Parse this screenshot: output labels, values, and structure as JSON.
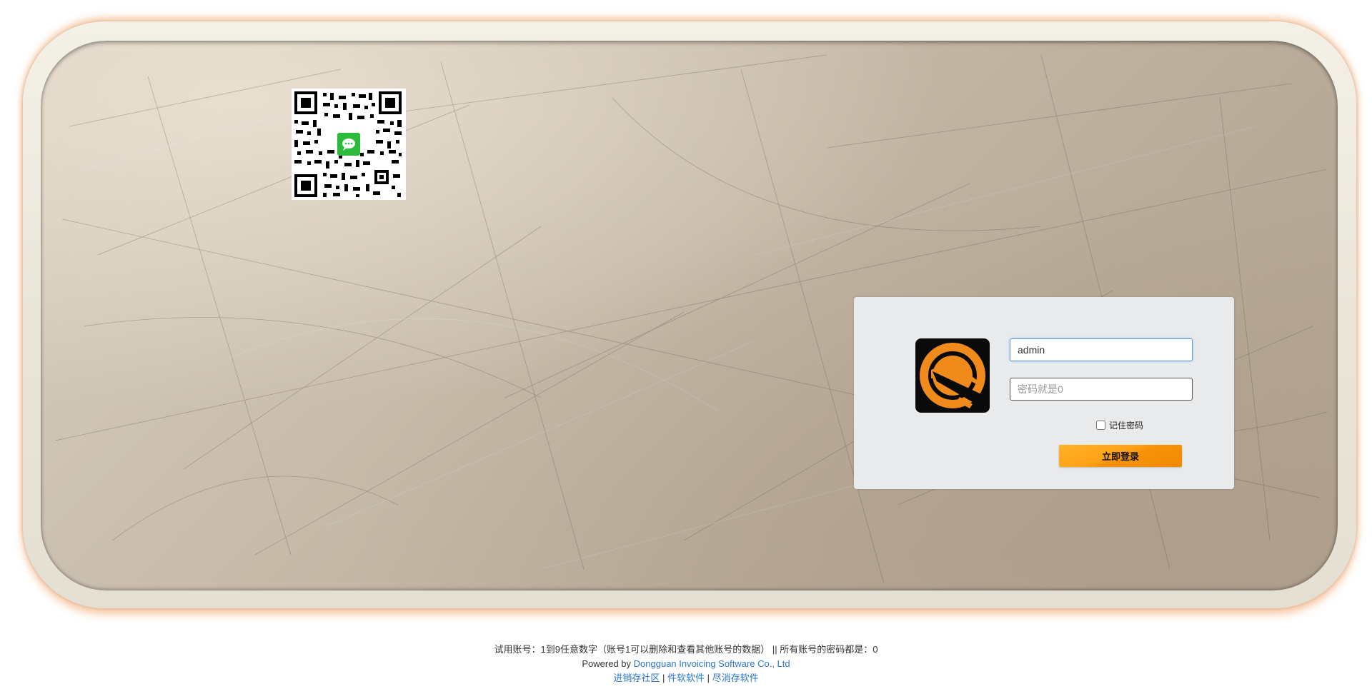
{
  "login": {
    "username_value": "admin",
    "password_placeholder": "密码就是0",
    "remember_label": "记住密码",
    "submit_label": "立即登录"
  },
  "footer": {
    "trial_note": "试用账号：1到9任意数字（账号1可以删除和查看其他账号的数据） || 所有账号的密码都是：0",
    "powered_by_label": "Powered by",
    "company_link": "Dongguan Invoicing Software Co., Ltd",
    "links": [
      "进销存社区",
      "件软软件",
      "尽消存软件"
    ],
    "separator": "|"
  },
  "colors": {
    "accent_orange": "#f39a11",
    "link_blue": "#2a77c9",
    "panel_bg": "#e9eaec",
    "logo_bg": "#0a0a0a"
  },
  "icons": {
    "qr": "wechat-qr-code",
    "logo": "company-logo-icon",
    "chat": "wechat-chat-icon"
  }
}
